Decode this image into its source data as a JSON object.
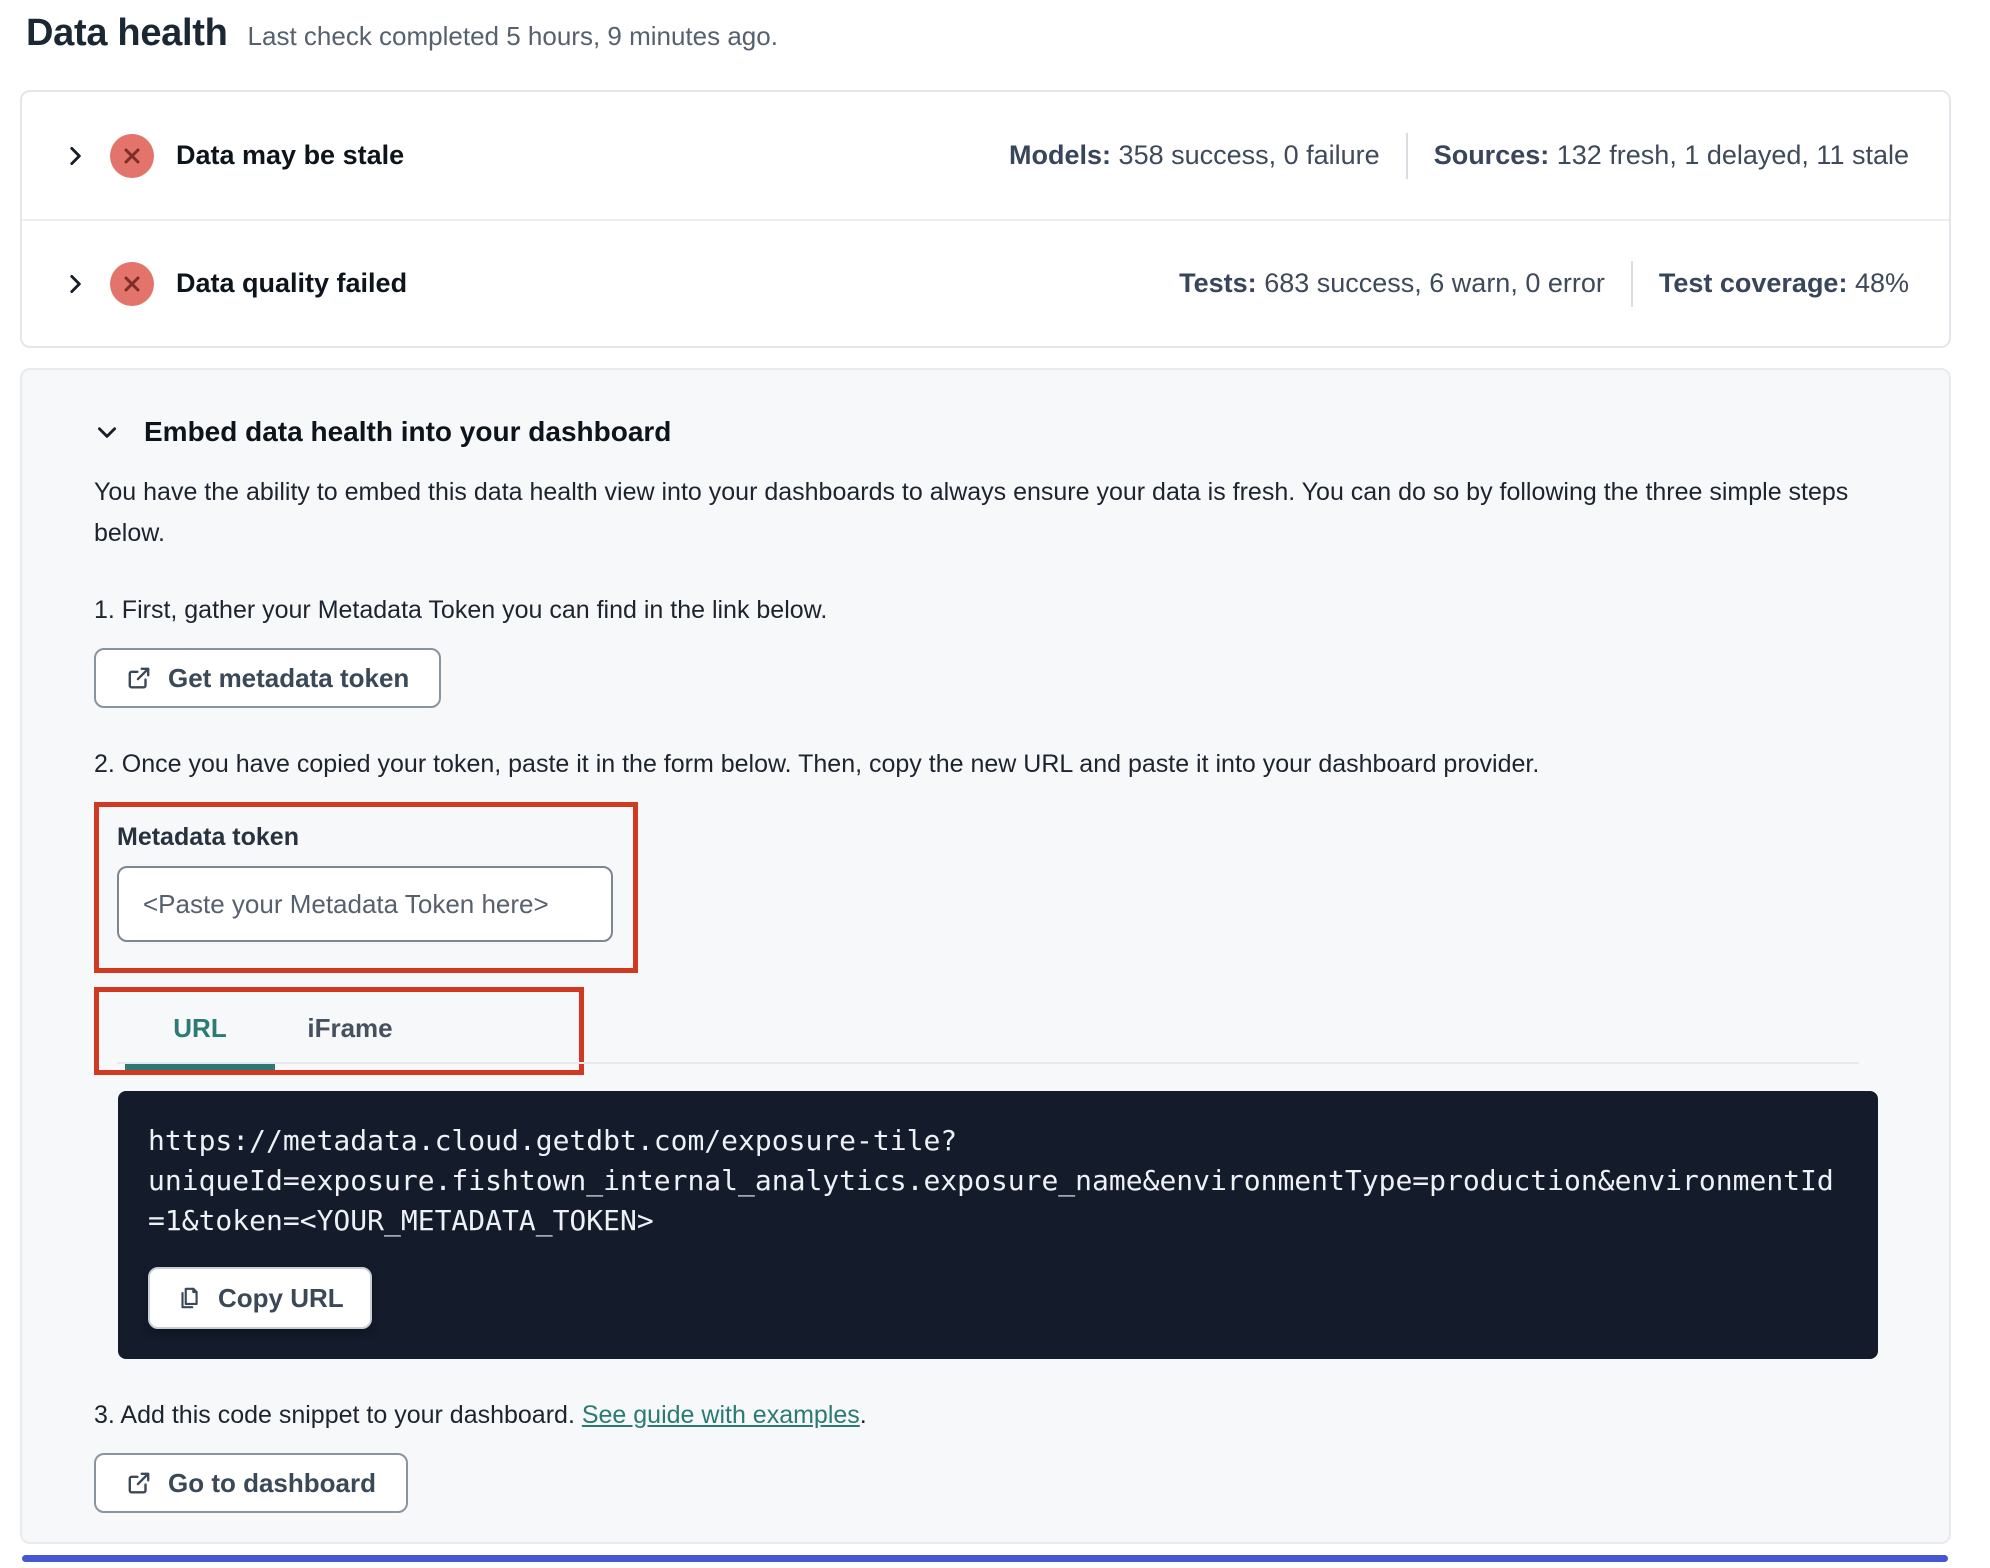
{
  "header": {
    "title": "Data health",
    "subtitle": "Last check completed 5 hours, 9 minutes ago."
  },
  "status_rows": [
    {
      "title": "Data may be stale",
      "stat1_label": "Models:",
      "stat1_value": "358 success, 0 failure",
      "stat2_label": "Sources:",
      "stat2_value": "132 fresh, 1 delayed, 11 stale"
    },
    {
      "title": "Data quality failed",
      "stat1_label": "Tests:",
      "stat1_value": "683 success, 6 warn, 0 error",
      "stat2_label": "Test coverage:",
      "stat2_value": "48%"
    }
  ],
  "embed": {
    "title": "Embed data health into your dashboard",
    "description": "You have the ability to embed this data health view into your dashboards to always ensure your data is fresh. You can do so by following the three simple steps below.",
    "step1_text": "1. First, gather your Metadata Token you can find in the link below.",
    "get_token_button": "Get metadata token",
    "step2_text": "2. Once you have copied your token, paste it in the form below. Then, copy the new URL and paste it into your dashboard provider.",
    "token_label": "Metadata token",
    "token_placeholder": "<Paste your Metadata Token here>",
    "tabs": {
      "url": "URL",
      "iframe": "iFrame"
    },
    "embed_url": "https://metadata.cloud.getdbt.com/exposure-tile?uniqueId=exposure.fishtown_internal_analytics.exposure_name&environmentType=production&environmentId=1&token=<YOUR_METADATA_TOKEN>",
    "copy_url_button": "Copy URL",
    "step3_text_before": "3. Add this code snippet to your dashboard. ",
    "step3_link": "See guide with examples",
    "step3_text_after": ".",
    "go_dashboard_button": "Go to dashboard"
  },
  "icons": {
    "status": "x-circle-icon",
    "row_expand": "chevron-right-icon",
    "section_collapse": "chevron-down-icon",
    "buttons": "external-link-icon",
    "copy": "copy-icon"
  },
  "colors": {
    "annotation_red": "#d13a20",
    "error_badge_red": "#e2746c",
    "accent_teal": "#2b7a74",
    "code_block_bg": "#141c2c",
    "bottom_bar_blue": "#4657d3"
  }
}
